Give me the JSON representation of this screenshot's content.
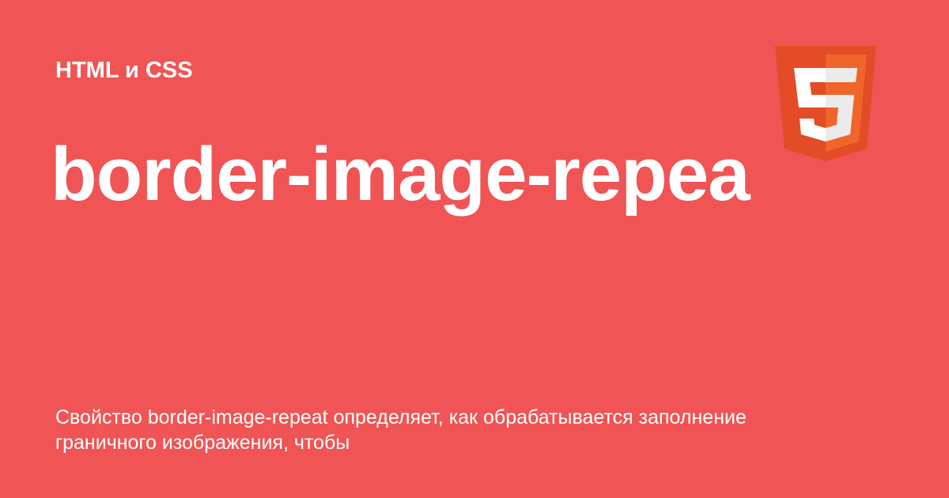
{
  "category": "HTML и CSS",
  "title": "border-image-repea",
  "description": "Свойство border-image-repeat определяет, как обрабатывается заполнение граничного изображения, чтобы",
  "logo": {
    "icon": "html5-logo-icon",
    "glyph": "5"
  },
  "colors": {
    "background": "#f05454",
    "text": "#ffffff",
    "logo_dark": "#e34c26",
    "logo_light": "#f06529"
  }
}
